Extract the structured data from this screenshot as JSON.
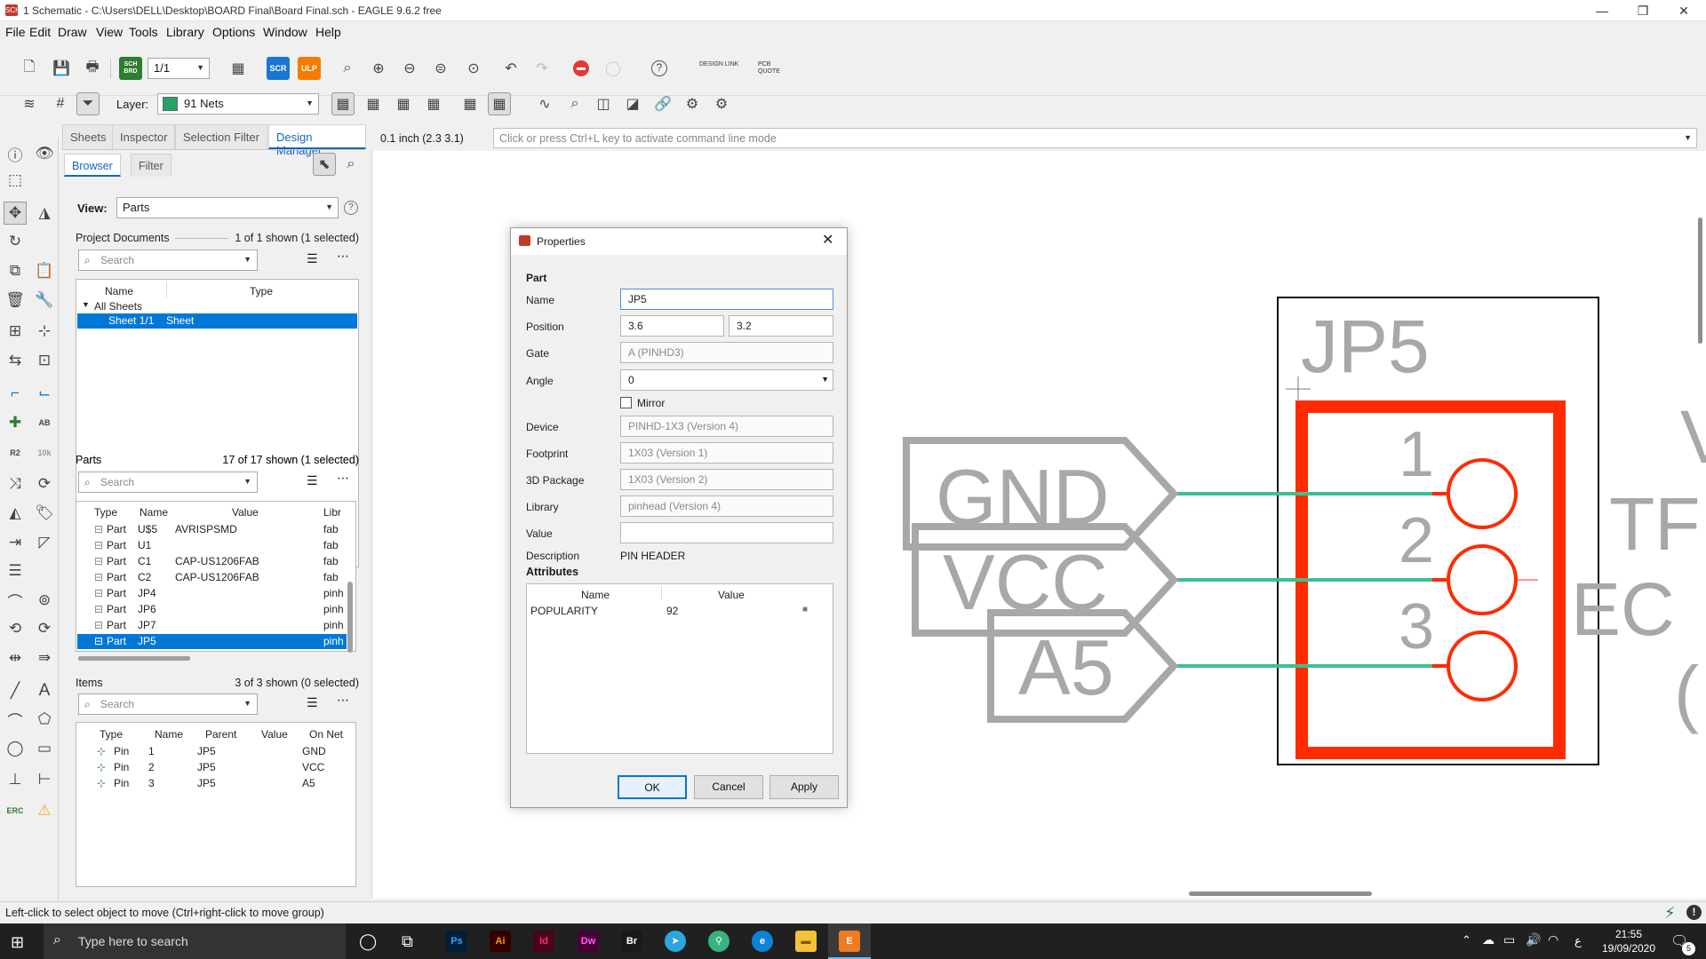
{
  "window": {
    "title": "1 Schematic - C:\\Users\\DELL\\Desktop\\BOARD Final\\Board Final.sch - EAGLE 9.6.2 free",
    "minimize": "—",
    "restore": "❐",
    "close": "✕"
  },
  "menu": [
    "File",
    "Edit",
    "Draw",
    "View",
    "Tools",
    "Library",
    "Options",
    "Window",
    "Help"
  ],
  "toolbar": {
    "sheet_combo": "1/1",
    "sch_brd": "SCH BRD",
    "scr": "SCR",
    "ulp": "ULP",
    "design_link": "DESIGN LINK",
    "pcb_quote": "PCB QUOTE",
    "help": "?",
    "layer_label": "Layer:",
    "layer_value": "91 Nets",
    "layer_color": "#26a269"
  },
  "panel": {
    "tabs": [
      "Sheets",
      "Inspector",
      "Selection Filter",
      "Design Manager"
    ],
    "active_tab": "Design Manager",
    "subtabs": [
      "Browser",
      "Filter"
    ],
    "view_label": "View:",
    "view_value": "Parts",
    "project_documents": {
      "label": "Project Documents",
      "count": "1 of 1 shown (1 selected)",
      "search_placeholder": "Search",
      "columns": [
        "Name",
        "Type"
      ],
      "tree_root": "All Sheets",
      "rows": [
        {
          "name": "Sheet 1/1",
          "type": "Sheet"
        }
      ]
    },
    "parts": {
      "label": "Parts",
      "count": "17 of 17 shown (1 selected)",
      "search_placeholder": "Search",
      "columns": [
        "Type",
        "Name",
        "Value",
        "Libr"
      ],
      "rows": [
        {
          "type": "Part",
          "name": "U$5",
          "value": "AVRISPSMD",
          "lib": "fab"
        },
        {
          "type": "Part",
          "name": "U1",
          "value": "",
          "lib": "fab"
        },
        {
          "type": "Part",
          "name": "C1",
          "value": "CAP-US1206FAB",
          "lib": "fab"
        },
        {
          "type": "Part",
          "name": "C2",
          "value": "CAP-US1206FAB",
          "lib": "fab"
        },
        {
          "type": "Part",
          "name": "JP4",
          "value": "",
          "lib": "pinh"
        },
        {
          "type": "Part",
          "name": "JP6",
          "value": "",
          "lib": "pinh"
        },
        {
          "type": "Part",
          "name": "JP7",
          "value": "",
          "lib": "pinh"
        },
        {
          "type": "Part",
          "name": "JP5",
          "value": "",
          "lib": "pinh"
        }
      ]
    },
    "items": {
      "label": "Items",
      "count": "3 of 3 shown (0 selected)",
      "search_placeholder": "Search",
      "columns": [
        "Type",
        "Name",
        "Parent",
        "Value",
        "On Net"
      ],
      "rows": [
        {
          "type": "Pin",
          "name": "1",
          "parent": "JP5",
          "value": "",
          "net": "GND"
        },
        {
          "type": "Pin",
          "name": "2",
          "parent": "JP5",
          "value": "",
          "net": "VCC"
        },
        {
          "type": "Pin",
          "name": "3",
          "parent": "JP5",
          "value": "",
          "net": "A5"
        }
      ]
    }
  },
  "canvas": {
    "coords": "0.1 inch (2.3 3.1)",
    "command_placeholder": "Click or press Ctrl+L key to activate command line mode",
    "part_label": "JP5",
    "net_labels": [
      "GND",
      "VCC",
      "A5"
    ],
    "pin_numbers": [
      "1",
      "2",
      "3"
    ],
    "partial_text": [
      "V",
      "TF",
      "EC",
      "("
    ],
    "net_color": "#3cbf93",
    "part_color": "#ff2a00",
    "label_color": "#a8a8a8"
  },
  "dialog": {
    "title": "Properties",
    "section_part": "Part",
    "name_label": "Name",
    "name_value": "JP5",
    "position_label": "Position",
    "position_x": "3.6",
    "position_y": "3.2",
    "gate_label": "Gate",
    "gate_value": "A (PINHD3)",
    "angle_label": "Angle",
    "angle_value": "0",
    "mirror_label": "Mirror",
    "device_label": "Device",
    "device_value": "PINHD-1X3 (Version 4)",
    "footprint_label": "Footprint",
    "footprint_value": "1X03 (Version 1)",
    "package3d_label": "3D Package",
    "package3d_value": "1X03 (Version 2)",
    "library_label": "Library",
    "library_value": "pinhead (Version 4)",
    "value_label": "Value",
    "value_value": "",
    "description_label": "Description",
    "description_value": "PIN HEADER",
    "attributes_label": "Attributes",
    "attr_columns": [
      "Name",
      "Value"
    ],
    "attributes": [
      {
        "name": "POPULARITY",
        "value": "92"
      }
    ],
    "ok": "OK",
    "cancel": "Cancel",
    "apply": "Apply"
  },
  "status": {
    "text": "Left-click to select object to move (Ctrl+right-click to move group)"
  },
  "taskbar": {
    "search_placeholder": "Type here to search",
    "apps": [
      "Ps",
      "Ai",
      "Id",
      "Dw",
      "Br"
    ],
    "time": "21:55",
    "date": "19/09/2020",
    "lang": "ع",
    "notifications": "5"
  }
}
